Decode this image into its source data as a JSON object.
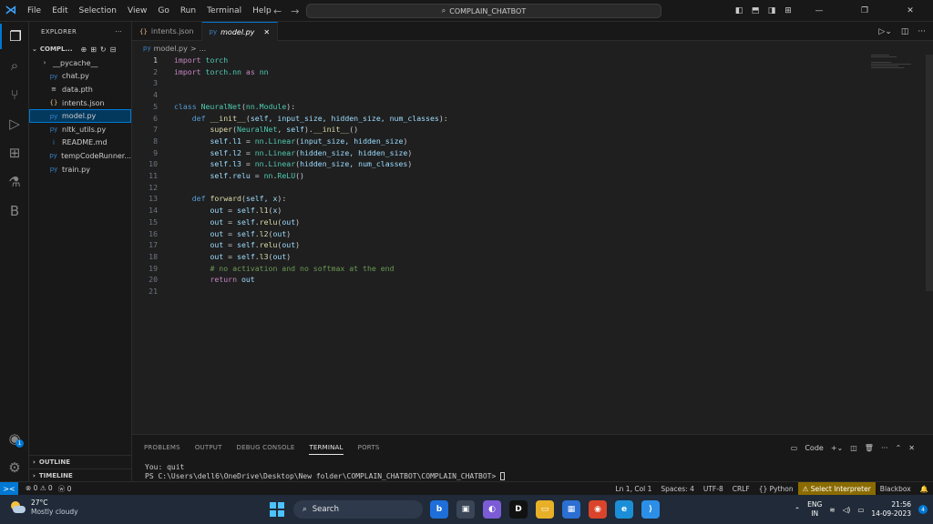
{
  "titlebar": {
    "menu": [
      "File",
      "Edit",
      "Selection",
      "View",
      "Go",
      "Run",
      "Terminal",
      "Help"
    ],
    "search_text": "COMPLAIN_CHATBOT"
  },
  "activity_icons": [
    "explorer-icon",
    "search-icon",
    "source-control-icon",
    "run-debug-icon",
    "extensions-icon",
    "testing-icon",
    "blackbox-icon",
    "accounts-icon",
    "settings-icon"
  ],
  "activity_letter": "B",
  "account_badge": "1",
  "sidebar": {
    "title": "EXPLORER",
    "more": "···",
    "folder": "COMPL...",
    "items": [
      {
        "name": "__pycache__",
        "icon": "›",
        "color": "#cccccc",
        "folder": true
      },
      {
        "name": "chat.py",
        "icon": "py",
        "color": "#3b82c4"
      },
      {
        "name": "data.pth",
        "icon": "≡",
        "color": "#cccccc"
      },
      {
        "name": "intents.json",
        "icon": "{}",
        "color": "#e2c08d"
      },
      {
        "name": "model.py",
        "icon": "py",
        "color": "#3b82c4",
        "selected": true
      },
      {
        "name": "nltk_utils.py",
        "icon": "py",
        "color": "#3b82c4"
      },
      {
        "name": "README.md",
        "icon": "i",
        "color": "#3b82c4"
      },
      {
        "name": "tempCodeRunner...",
        "icon": "py",
        "color": "#3b82c4"
      },
      {
        "name": "train.py",
        "icon": "py",
        "color": "#3b82c4"
      }
    ],
    "outline": "OUTLINE",
    "timeline": "TIMELINE"
  },
  "tabs": [
    {
      "label": "intents.json",
      "icon": "{}",
      "active": false
    },
    {
      "label": "model.py",
      "icon": "py",
      "active": true,
      "close": "✕"
    }
  ],
  "breadcrumb": {
    "file": "model.py",
    "sep": ">",
    "rest": "..."
  },
  "code": [
    {
      "n": "1",
      "t": [
        [
          "kw",
          "import "
        ],
        [
          "cls",
          "torch"
        ]
      ]
    },
    {
      "n": "2",
      "t": [
        [
          "kw",
          "import "
        ],
        [
          "cls",
          "torch.nn "
        ],
        [
          "kw",
          "as "
        ],
        [
          "cls",
          "nn"
        ]
      ]
    },
    {
      "n": "3",
      "t": []
    },
    {
      "n": "4",
      "t": []
    },
    {
      "n": "5",
      "t": [
        [
          "kd",
          "class "
        ],
        [
          "cls",
          "NeuralNet"
        ],
        [
          "p",
          "("
        ],
        [
          "cls",
          "nn.Module"
        ],
        [
          "p",
          "):"
        ]
      ]
    },
    {
      "n": "6",
      "t": [
        [
          "p",
          "    "
        ],
        [
          "kd",
          "def "
        ],
        [
          "fn",
          "__init__"
        ],
        [
          "p",
          "("
        ],
        [
          "var",
          "self, input_size, hidden_size, num_classes"
        ],
        [
          "p",
          "):"
        ]
      ]
    },
    {
      "n": "7",
      "t": [
        [
          "p",
          "        "
        ],
        [
          "fn",
          "super"
        ],
        [
          "p",
          "("
        ],
        [
          "cls",
          "NeuralNet"
        ],
        [
          "p",
          ", "
        ],
        [
          "var",
          "self"
        ],
        [
          "p",
          ")."
        ],
        [
          "fn",
          "__init__"
        ],
        [
          "p",
          "()"
        ]
      ]
    },
    {
      "n": "8",
      "t": [
        [
          "p",
          "        "
        ],
        [
          "var",
          "self.l1"
        ],
        [
          "p",
          " = "
        ],
        [
          "cls",
          "nn"
        ],
        [
          "p",
          "."
        ],
        [
          "cls",
          "Linear"
        ],
        [
          "p",
          "("
        ],
        [
          "var",
          "input_size, hidden_size"
        ],
        [
          "p",
          ")"
        ]
      ]
    },
    {
      "n": "9",
      "t": [
        [
          "p",
          "        "
        ],
        [
          "var",
          "self.l2"
        ],
        [
          "p",
          " = "
        ],
        [
          "cls",
          "nn"
        ],
        [
          "p",
          "."
        ],
        [
          "cls",
          "Linear"
        ],
        [
          "p",
          "("
        ],
        [
          "var",
          "hidden_size, hidden_size"
        ],
        [
          "p",
          ")"
        ]
      ]
    },
    {
      "n": "10",
      "t": [
        [
          "p",
          "        "
        ],
        [
          "var",
          "self.l3"
        ],
        [
          "p",
          " = "
        ],
        [
          "cls",
          "nn"
        ],
        [
          "p",
          "."
        ],
        [
          "cls",
          "Linear"
        ],
        [
          "p",
          "("
        ],
        [
          "var",
          "hidden_size, num_classes"
        ],
        [
          "p",
          ")"
        ]
      ]
    },
    {
      "n": "11",
      "t": [
        [
          "p",
          "        "
        ],
        [
          "var",
          "self.relu"
        ],
        [
          "p",
          " = "
        ],
        [
          "cls",
          "nn"
        ],
        [
          "p",
          "."
        ],
        [
          "cls",
          "ReLU"
        ],
        [
          "p",
          "()"
        ]
      ]
    },
    {
      "n": "12",
      "t": []
    },
    {
      "n": "13",
      "t": [
        [
          "p",
          "    "
        ],
        [
          "kd",
          "def "
        ],
        [
          "fn",
          "forward"
        ],
        [
          "p",
          "("
        ],
        [
          "var",
          "self, x"
        ],
        [
          "p",
          "):"
        ]
      ]
    },
    {
      "n": "14",
      "t": [
        [
          "p",
          "        "
        ],
        [
          "var",
          "out"
        ],
        [
          "p",
          " = "
        ],
        [
          "var",
          "self"
        ],
        [
          "p",
          "."
        ],
        [
          "fn",
          "l1"
        ],
        [
          "p",
          "("
        ],
        [
          "var",
          "x"
        ],
        [
          "p",
          ")"
        ]
      ]
    },
    {
      "n": "15",
      "t": [
        [
          "p",
          "        "
        ],
        [
          "var",
          "out"
        ],
        [
          "p",
          " = "
        ],
        [
          "var",
          "self"
        ],
        [
          "p",
          "."
        ],
        [
          "fn",
          "relu"
        ],
        [
          "p",
          "("
        ],
        [
          "var",
          "out"
        ],
        [
          "p",
          ")"
        ]
      ]
    },
    {
      "n": "16",
      "t": [
        [
          "p",
          "        "
        ],
        [
          "var",
          "out"
        ],
        [
          "p",
          " = "
        ],
        [
          "var",
          "self"
        ],
        [
          "p",
          "."
        ],
        [
          "fn",
          "l2"
        ],
        [
          "p",
          "("
        ],
        [
          "var",
          "out"
        ],
        [
          "p",
          ")"
        ]
      ]
    },
    {
      "n": "17",
      "t": [
        [
          "p",
          "        "
        ],
        [
          "var",
          "out"
        ],
        [
          "p",
          " = "
        ],
        [
          "var",
          "self"
        ],
        [
          "p",
          "."
        ],
        [
          "fn",
          "relu"
        ],
        [
          "p",
          "("
        ],
        [
          "var",
          "out"
        ],
        [
          "p",
          ")"
        ]
      ]
    },
    {
      "n": "18",
      "t": [
        [
          "p",
          "        "
        ],
        [
          "var",
          "out"
        ],
        [
          "p",
          " = "
        ],
        [
          "var",
          "self"
        ],
        [
          "p",
          "."
        ],
        [
          "fn",
          "l3"
        ],
        [
          "p",
          "("
        ],
        [
          "var",
          "out"
        ],
        [
          "p",
          ")"
        ]
      ]
    },
    {
      "n": "19",
      "t": [
        [
          "p",
          "        "
        ],
        [
          "cmt",
          "# no activation and no softmax at the end"
        ]
      ]
    },
    {
      "n": "20",
      "t": [
        [
          "p",
          "        "
        ],
        [
          "kw",
          "return "
        ],
        [
          "var",
          "out"
        ]
      ]
    },
    {
      "n": "21",
      "t": []
    }
  ],
  "panel": {
    "tabs": [
      "PROBLEMS",
      "OUTPUT",
      "DEBUG CONSOLE",
      "TERMINAL",
      "PORTS"
    ],
    "active": "TERMINAL",
    "shell": "Code",
    "lines": [
      "You: quit",
      "PS C:\\Users\\dell6\\OneDrive\\Desktop\\New folder\\COMPLAIN_CHATBOT\\COMPLAIN_CHATBOT> "
    ]
  },
  "statusbar": {
    "remote": "><",
    "errors": "⊗ 0 ⚠ 0",
    "ports": "ⓦ 0",
    "right": [
      "Ln 1, Col 1",
      "Spaces: 4",
      "UTF-8",
      "CRLF",
      "{} Python"
    ],
    "interpreter": "⚠ Select Interpreter",
    "blackbox": "Blackbox"
  },
  "taskbar": {
    "temp": "27°C",
    "weather": "Mostly cloudy",
    "search": "Search",
    "apps": [
      {
        "name": "bing-icon",
        "label": "b",
        "color": "#1e6fd9"
      },
      {
        "name": "task-view-icon",
        "label": "▣",
        "color": "#3a4556"
      },
      {
        "name": "meet-icon",
        "label": "◐",
        "color": "#7b5cd6"
      },
      {
        "name": "dell-icon",
        "label": "D",
        "color": "#111111"
      },
      {
        "name": "file-explorer-icon",
        "label": "▭",
        "color": "#e8b027"
      },
      {
        "name": "store-icon",
        "label": "▦",
        "color": "#2a6fd1"
      },
      {
        "name": "chrome-icon",
        "label": "◉",
        "color": "#d9442b"
      },
      {
        "name": "edge-icon",
        "label": "e",
        "color": "#1a8fd8"
      },
      {
        "name": "vscode-icon",
        "label": "⟩",
        "color": "#2b8fe8"
      }
    ],
    "lang1": "ENG",
    "lang2": "IN",
    "time": "21:56",
    "date": "14-09-2023",
    "notif": "4"
  }
}
